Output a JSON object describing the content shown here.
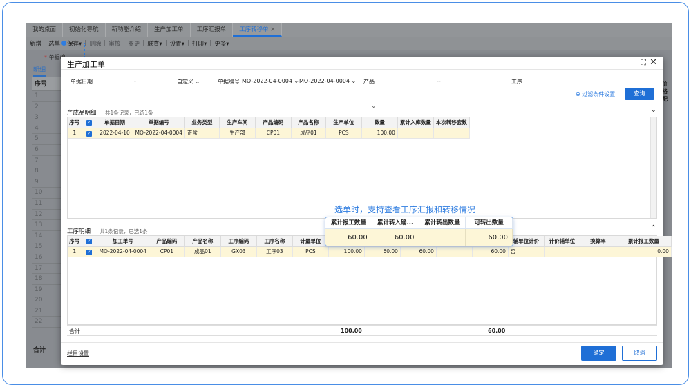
{
  "tabs": [
    "我的桌面",
    "初始化导航",
    "新功能介绍",
    "生产加工单",
    "工序汇报单",
    "工序转移单"
  ],
  "active_tab_close": "×",
  "toolbar": [
    "新增",
    "选单",
    "保存",
    "删除",
    "审核",
    "变更",
    "联查",
    "设置",
    "打印",
    "更多"
  ],
  "bg": {
    "required": "单据编",
    "detail_tab": "明细",
    "seq": "序号",
    "rows": [
      "1",
      "2",
      "3",
      "4",
      "5",
      "6",
      "7",
      "8",
      "9",
      "10",
      "11",
      "12",
      "13",
      "14",
      "15",
      "16",
      "17",
      "18",
      "19",
      "20",
      "21",
      "22"
    ],
    "total": "合计",
    "right_col": "价格配"
  },
  "modal": {
    "title": "生产加工单",
    "filters": {
      "date_label": "单据日期",
      "date_sep": "-",
      "date_mode": "自定义",
      "no_label": "单据编号",
      "no_from": "MO-2022-04-0004",
      "no_to": "MO-2022-04-0004",
      "no_sep": "~",
      "product_label": "产品",
      "product_sep": "--",
      "process_label": "工序",
      "more_filters": "过滤条件设置",
      "query": "查询"
    },
    "product_section": {
      "title": "产成品明细",
      "info": "共1条记录，已选1条",
      "headers": [
        "序号",
        "",
        "单据日期",
        "单据编号",
        "业务类型",
        "生产车间",
        "产品编码",
        "产品名称",
        "生产单位",
        "数量",
        "累计入库数量",
        "本次转移套数"
      ],
      "rows": [
        [
          "1",
          "",
          "2022-04-10",
          "MO-2022-04-0004",
          "正常",
          "生产部",
          "CP01",
          "成品01",
          "PCS",
          "100.00",
          "",
          ""
        ]
      ]
    },
    "process_section": {
      "title": "工序明细",
      "info": "共1条记录，已选1条",
      "headers": [
        "序号",
        "",
        "加工单号",
        "产品编码",
        "产品名称",
        "工序编码",
        "工序名称",
        "计量单位",
        "",
        "",
        "",
        "",
        "",
        "辅单位计价",
        "计价辅单位",
        "换算率",
        "累计报工数量"
      ],
      "rows": [
        [
          "1",
          "",
          "MO-2022-04-0004",
          "CP01",
          "成品01",
          "GX03",
          "工序03",
          "PCS",
          "100.00",
          "60.00",
          "60.00",
          "",
          "60.00",
          "否",
          "",
          "",
          "0.00"
        ]
      ],
      "total_label": "合计",
      "total_qty": "100.00",
      "total_transfer": "60.00"
    },
    "callout": {
      "caption": "选单时，支持查看工序汇报和转移情况",
      "headers": [
        "累计报工数量",
        "累计转入确...",
        "累计转出数量",
        "可转出数量"
      ],
      "values": [
        "60.00",
        "60.00",
        "",
        "60.00"
      ]
    },
    "column_settings": "栏目设置",
    "ok": "确定",
    "cancel": "取消"
  }
}
